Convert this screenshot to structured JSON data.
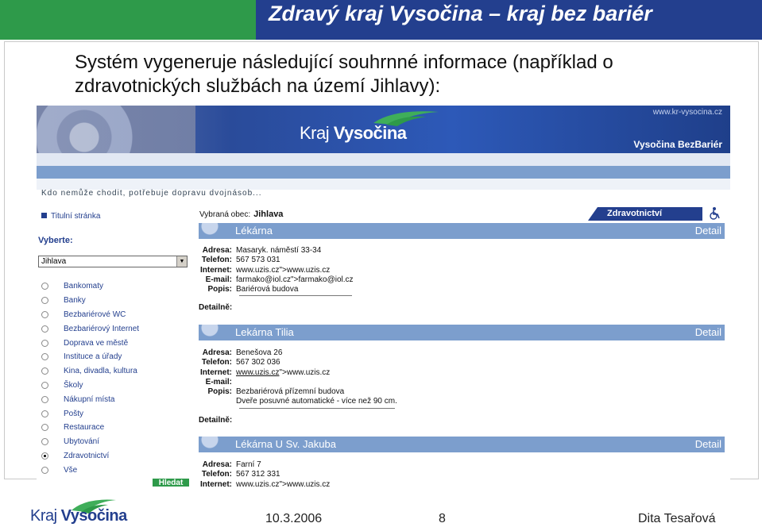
{
  "slide": {
    "title": "Zdravý kraj Vysočina – kraj bez bariér",
    "intro": "Systém vygeneruje následující souhrnné informace (například o zdravotnických službách na území Jihlavy):"
  },
  "colors": {
    "green": "#2e9a4a",
    "blue": "#233f8e",
    "header_blue": "#7c9ecd"
  },
  "screenshot": {
    "banner": {
      "logo_main": "Kraj",
      "logo_accent": "Vysočina",
      "url": "www.kr-vysocina.cz",
      "subtitle": "Vysočina BezBariér"
    },
    "tagline": "Kdo nemůže chodit, potřebuje dopravu dvojnásob...",
    "nav": {
      "home": "Titulní stránka",
      "choose_label": "Vyberte:",
      "select_value": "Jihlava",
      "items": [
        {
          "label": "Bankomaty",
          "selected": false
        },
        {
          "label": "Banky",
          "selected": false
        },
        {
          "label": "Bezbariérové WC",
          "selected": false
        },
        {
          "label": "Bezbariérový Internet",
          "selected": false
        },
        {
          "label": "Doprava ve městě",
          "selected": false
        },
        {
          "label": "Instituce a úřady",
          "selected": false
        },
        {
          "label": "Kina, divadla, kultura",
          "selected": false
        },
        {
          "label": "Školy",
          "selected": false
        },
        {
          "label": "Nákupní místa",
          "selected": false
        },
        {
          "label": "Pošty",
          "selected": false
        },
        {
          "label": "Restaurace",
          "selected": false
        },
        {
          "label": "Ubytování",
          "selected": false
        },
        {
          "label": "Zdravotnictví",
          "selected": true
        },
        {
          "label": "Vše",
          "selected": false
        }
      ],
      "search_button": "Hledat"
    },
    "content": {
      "selected_town_label": "Vybraná obec:",
      "selected_town": "Jihlava",
      "category_tab": "Zdravotnictví",
      "labels": {
        "address": "Adresa:",
        "phone": "Telefon:",
        "internet": "Internet:",
        "email": "E-mail:",
        "desc": "Popis:",
        "detail": "Detailně:"
      },
      "records": [
        {
          "name": "Lékárna",
          "detail_link": "Detail",
          "address": "Masaryk. náměstí 33-34",
          "phone": "567 573 031",
          "internet": "www.uzis.cz\">www.uzis.cz",
          "email": "farmako@iol.cz\">farmako@iol.cz",
          "desc": [
            "Bariérová budova"
          ]
        },
        {
          "name": "Lekárna Tilia",
          "detail_link": "Detail",
          "address": "Benešova 26",
          "phone": "567 302 036",
          "internet_link": "www.uzis.cz",
          "internet_rest": "\">www.uzis.cz",
          "email": "",
          "desc": [
            "Bezbariérová přízemní budova",
            "Dveře posuvné automatické - více než 90 cm."
          ]
        },
        {
          "name": "Lékárna U Sv. Jakuba",
          "detail_link": "Detail",
          "address": "Farní 7",
          "phone": "567 312 331",
          "internet_link": "www.uzis.cz",
          "internet_rest": "\">www.uzis.cz"
        }
      ]
    }
  },
  "footer": {
    "logo_main": "Kraj",
    "logo_accent": "Vysočina",
    "date": "10.3.2006",
    "page": "8",
    "author": "Dita Tesařová"
  }
}
